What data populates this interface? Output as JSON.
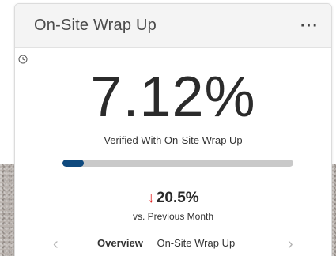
{
  "widget": {
    "title": "On-Site Wrap Up",
    "menu_label": "···",
    "value": "7.12%",
    "subtitle": "Verified With On-Site Wrap Up",
    "progress_fraction": 0.0712,
    "delta": {
      "direction": "down",
      "arrow": "↓",
      "value": "20.5%",
      "comparison": "vs. Previous Month",
      "color": "#e01f1f"
    },
    "nav": {
      "prev": "‹",
      "next": "›",
      "tabs": [
        {
          "label": "Overview",
          "active": true
        },
        {
          "label": "On-Site Wrap Up",
          "active": false
        }
      ]
    }
  },
  "colors": {
    "progress_fill": "#0f4a7e",
    "progress_track": "#c9c9c9",
    "header_bg": "#f4f4f4"
  },
  "icons": {
    "clock": "clock-icon",
    "more": "more-icon"
  }
}
